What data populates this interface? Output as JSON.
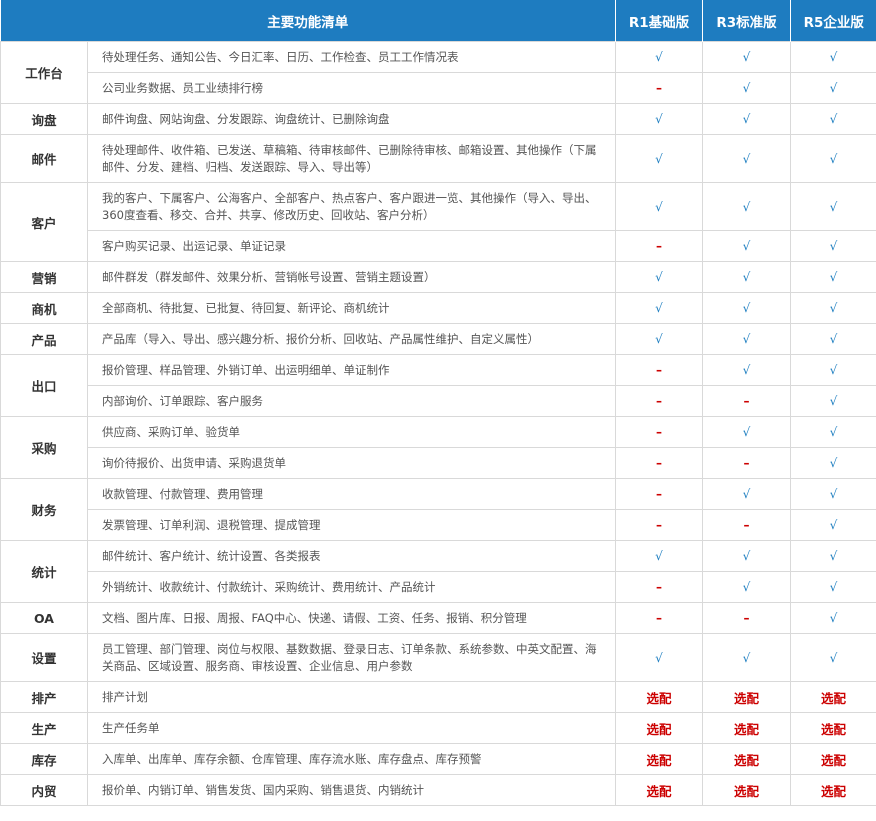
{
  "header": {
    "feature_list": "主要功能清单",
    "r1": "R1基础版",
    "r3": "R3标准版",
    "r5": "R5企业版"
  },
  "marks": {
    "yes": "√",
    "no": "–",
    "optional": "选配"
  },
  "modules": [
    {
      "name": "工作台",
      "rows": [
        {
          "text": "待处理任务、通知公告、今日汇率、日历、工作检查、员工工作情况表",
          "r1": "yes",
          "r3": "yes",
          "r5": "yes",
          "tall": false
        },
        {
          "text": "公司业务数据、员工业绩排行榜",
          "r1": "no",
          "r3": "yes",
          "r5": "yes",
          "tall": false
        }
      ]
    },
    {
      "name": "询盘",
      "rows": [
        {
          "text": "邮件询盘、网站询盘、分发跟踪、询盘统计、已删除询盘",
          "r1": "yes",
          "r3": "yes",
          "r5": "yes",
          "tall": false
        }
      ]
    },
    {
      "name": "邮件",
      "rows": [
        {
          "text": "待处理邮件、收件箱、已发送、草稿箱、待审核邮件、已删除待审核、邮箱设置、其他操作（下属邮件、分发、建档、归档、发送跟踪、导入、导出等）",
          "r1": "yes",
          "r3": "yes",
          "r5": "yes",
          "tall": true
        }
      ]
    },
    {
      "name": "客户",
      "rows": [
        {
          "text": "我的客户、下属客户、公海客户、全部客户、热点客户、客户跟进一览、其他操作（导入、导出、360度查看、移交、合并、共享、修改历史、回收站、客户分析）",
          "r1": "yes",
          "r3": "yes",
          "r5": "yes",
          "tall": true
        },
        {
          "text": "客户购买记录、出运记录、单证记录",
          "r1": "no",
          "r3": "yes",
          "r5": "yes",
          "tall": false
        }
      ]
    },
    {
      "name": "营销",
      "rows": [
        {
          "text": "邮件群发（群发邮件、效果分析、营销帐号设置、营销主题设置）",
          "r1": "yes",
          "r3": "yes",
          "r5": "yes",
          "tall": false
        }
      ]
    },
    {
      "name": "商机",
      "rows": [
        {
          "text": "全部商机、待批复、已批复、待回复、新评论、商机统计",
          "r1": "yes",
          "r3": "yes",
          "r5": "yes",
          "tall": false
        }
      ]
    },
    {
      "name": "产品",
      "rows": [
        {
          "text": "产品库（导入、导出、感兴趣分析、报价分析、回收站、产品属性维护、自定义属性）",
          "r1": "yes",
          "r3": "yes",
          "r5": "yes",
          "tall": false
        }
      ]
    },
    {
      "name": "出口",
      "rows": [
        {
          "text": "报价管理、样品管理、外销订单、出运明细单、单证制作",
          "r1": "no",
          "r3": "yes",
          "r5": "yes",
          "tall": false
        },
        {
          "text": "内部询价、订单跟踪、客户服务",
          "r1": "no",
          "r3": "no",
          "r5": "yes",
          "tall": false
        }
      ]
    },
    {
      "name": "采购",
      "rows": [
        {
          "text": "供应商、采购订单、验货单",
          "r1": "no",
          "r3": "yes",
          "r5": "yes",
          "tall": false
        },
        {
          "text": "询价待报价、出货申请、采购退货单",
          "r1": "no",
          "r3": "no",
          "r5": "yes",
          "tall": false
        }
      ]
    },
    {
      "name": "财务",
      "rows": [
        {
          "text": "收款管理、付款管理、费用管理",
          "r1": "no",
          "r3": "yes",
          "r5": "yes",
          "tall": false
        },
        {
          "text": "发票管理、订单利润、退税管理、提成管理",
          "r1": "no",
          "r3": "no",
          "r5": "yes",
          "tall": false
        }
      ]
    },
    {
      "name": "统计",
      "rows": [
        {
          "text": "邮件统计、客户统计、统计设置、各类报表",
          "r1": "yes",
          "r3": "yes",
          "r5": "yes",
          "tall": false
        },
        {
          "text": "外销统计、收款统计、付款统计、采购统计、费用统计、产品统计",
          "r1": "no",
          "r3": "yes",
          "r5": "yes",
          "tall": false
        }
      ]
    },
    {
      "name": "OA",
      "rows": [
        {
          "text": "文档、图片库、日报、周报、FAQ中心、快递、请假、工资、任务、报销、积分管理",
          "r1": "no",
          "r3": "no",
          "r5": "yes",
          "tall": false
        }
      ]
    },
    {
      "name": "设置",
      "rows": [
        {
          "text": "员工管理、部门管理、岗位与权限、基数数据、登录日志、订单条款、系统参数、中英文配置、海关商品、区域设置、服务商、审核设置、企业信息、用户参数",
          "r1": "yes",
          "r3": "yes",
          "r5": "yes",
          "tall": true
        }
      ]
    },
    {
      "name": "排产",
      "rows": [
        {
          "text": "排产计划",
          "r1": "optional",
          "r3": "optional",
          "r5": "optional",
          "tall": false
        }
      ]
    },
    {
      "name": "生产",
      "rows": [
        {
          "text": "生产任务单",
          "r1": "optional",
          "r3": "optional",
          "r5": "optional",
          "tall": false
        }
      ]
    },
    {
      "name": "库存",
      "rows": [
        {
          "text": "入库单、出库单、库存余额、仓库管理、库存流水账、库存盘点、库存预警",
          "r1": "optional",
          "r3": "optional",
          "r5": "optional",
          "tall": false
        }
      ]
    },
    {
      "name": "内贸",
      "rows": [
        {
          "text": "报价单、内销订单、销售发货、国内采购、销售退货、内销统计",
          "r1": "optional",
          "r3": "optional",
          "r5": "optional",
          "tall": false
        }
      ]
    }
  ]
}
